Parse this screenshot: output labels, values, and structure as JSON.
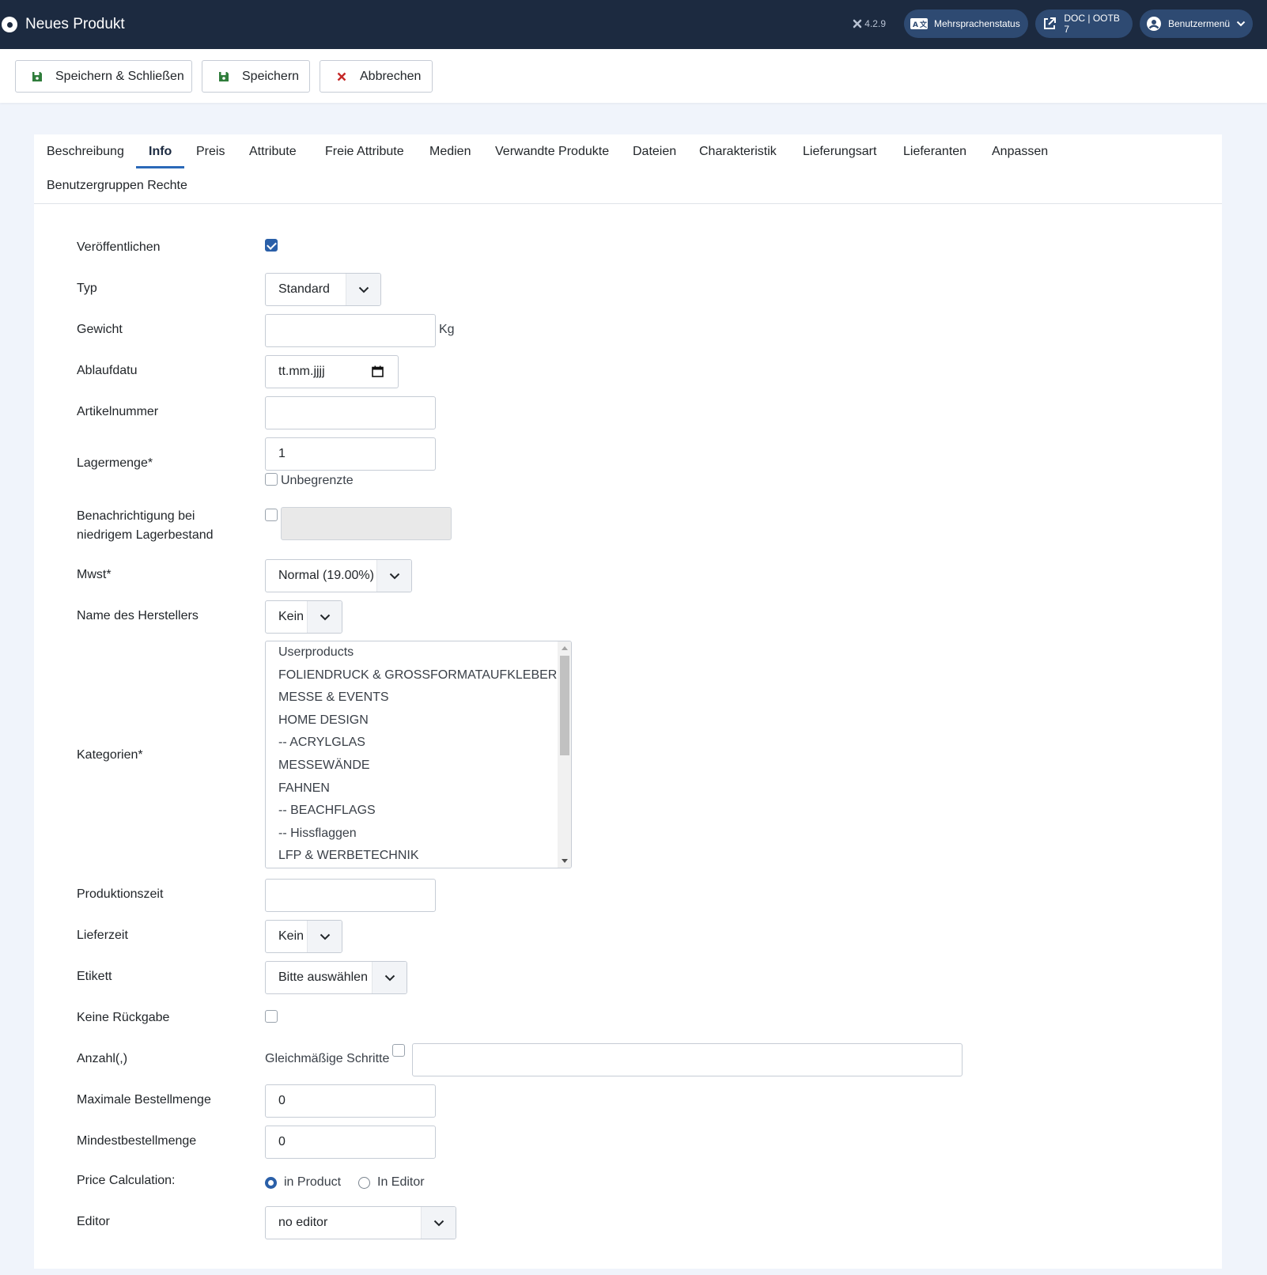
{
  "header": {
    "title": "Neues Produkt",
    "version": "4.2.9",
    "multilang_label": "Mehrsprachenstatus",
    "site_label": "DOC | OOTB 7",
    "user_menu_label": "Benutzermenü"
  },
  "toolbar": {
    "save_close_label": "Speichern & Schließen",
    "save_label": "Speichern",
    "cancel_label": "Abbrechen"
  },
  "tabs": [
    {
      "label": "Beschreibung"
    },
    {
      "label": "Info",
      "active": true
    },
    {
      "label": "Preis"
    },
    {
      "label": "Attribute"
    },
    {
      "label": "Freie Attribute"
    },
    {
      "label": "Medien"
    },
    {
      "label": "Verwandte Produkte"
    },
    {
      "label": "Dateien"
    },
    {
      "label": "Charakteristik"
    },
    {
      "label": "Lieferungsart"
    },
    {
      "label": "Lieferanten"
    },
    {
      "label": "Anpassen"
    },
    {
      "label": "Benutzergruppen Rechte"
    }
  ],
  "form": {
    "publish": {
      "label": "Veröffentlichen",
      "checked": true
    },
    "type": {
      "label": "Typ",
      "value": "Standard"
    },
    "weight": {
      "label": "Gewicht",
      "value": "",
      "unit": "Kg"
    },
    "expiry": {
      "label": "Ablaufdatu",
      "placeholder": "tt.mm.jjjj"
    },
    "article_number": {
      "label": "Artikelnummer",
      "value": ""
    },
    "stock": {
      "label": "Lagermenge*",
      "value": "1",
      "unlimited_label": "Unbegrenzte",
      "unlimited_checked": false
    },
    "low_stock": {
      "label_line1": "Benachrichtigung bei",
      "label_line2": "niedrigem Lagerbestand",
      "checked": false,
      "value": ""
    },
    "tax": {
      "label": "Mwst*",
      "value": "Normal (19.00%)"
    },
    "manufacturer": {
      "label": "Name des Herstellers",
      "value": "Kein"
    },
    "categories": {
      "label": "Kategorien*",
      "options": [
        "Userproducts",
        "FOLIENDRUCK & GROSSFORMATAUFKLEBER",
        "MESSE & EVENTS",
        "HOME DESIGN",
        "-- ACRYLGLAS",
        "MESSEWÄNDE",
        "FAHNEN",
        "-- BEACHFLAGS",
        "-- Hissflaggen",
        "LFP & WERBETECHNIK"
      ]
    },
    "production_time": {
      "label": "Produktionszeit",
      "value": ""
    },
    "delivery_time": {
      "label": "Lieferzeit",
      "value": "Kein"
    },
    "label_field": {
      "label": "Etikett",
      "value": "Bitte auswählen"
    },
    "no_return": {
      "label": "Keine Rückgabe",
      "checked": false
    },
    "quantity": {
      "label": "Anzahl(,)",
      "even_steps_label": "Gleichmäßige Schritte",
      "even_steps_checked": false,
      "value": ""
    },
    "max_order": {
      "label": "Maximale Bestellmenge",
      "value": "0"
    },
    "min_order": {
      "label": "Mindestbestellmenge",
      "value": "0"
    },
    "price_calc": {
      "label": "Price Calculation:",
      "option1": "in Product",
      "option2": "In Editor",
      "selected": "in Product"
    },
    "editor": {
      "label": "Editor",
      "value": "no editor"
    }
  }
}
